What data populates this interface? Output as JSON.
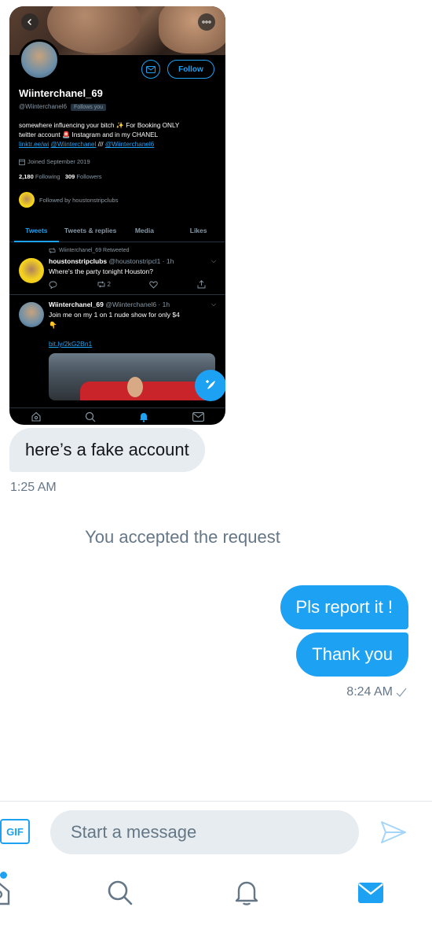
{
  "embedded_screenshot": {
    "profile": {
      "display_name": "Wiinterchanel_69",
      "handle": "@Wiinterchanel6",
      "follows_you_badge": "Follows you",
      "follow_label": "Follow",
      "bio_line1": "somewhere influencing your bitch ✨ For Booking ONLY",
      "bio_line2": "twitter account 🚨 Instagram and in my CHANEL",
      "bio_link1": "linktr.ee/wi",
      "bio_link2": "@Wiinterchanel",
      "bio_sep": "///",
      "bio_link3": "@Wiinterchanel6",
      "joined": "Joined September 2019",
      "following_count": "2,180",
      "following_label": "Following",
      "followers_count": "309",
      "followers_label": "Followers",
      "followed_by": "Followed by houstonstripclubs"
    },
    "tabs": [
      "Tweets",
      "Tweets & replies",
      "Media",
      "Likes"
    ],
    "tweets": [
      {
        "retweet_note": "Wiinterchanel_69 Retweeted",
        "author": "houstonstripclubs",
        "meta": "@houstonstripcl1 · 1h",
        "text": "Where's the party tonight Houston?",
        "retweets": "2"
      },
      {
        "author": "Wiinterchanel_69",
        "meta": "@Wiinterchanel6 · 1h",
        "text_line1": "Join me on my 1 on 1 nude show for only $4",
        "text_line2": "👇",
        "link": "bit.ly/2kG2Bn1"
      }
    ]
  },
  "conversation": {
    "incoming_message": "here’s a fake account",
    "incoming_time": "1:25 AM",
    "system_note": "You accepted the request",
    "outgoing_messages": [
      "Pls report it !",
      "Thank you"
    ],
    "outgoing_time": "8:24 AM"
  },
  "composer": {
    "gif_label": "GIF",
    "placeholder": "Start a message"
  },
  "colors": {
    "accent": "#1da1f2",
    "incoming_bubble": "#e6ecf0",
    "muted_text": "#657786"
  }
}
